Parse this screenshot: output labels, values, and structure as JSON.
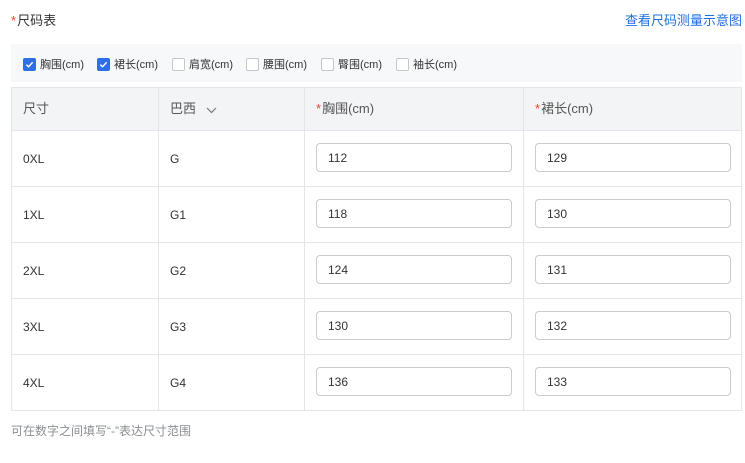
{
  "header": {
    "required_mark": "*",
    "title": "尺码表",
    "guide_link": "查看尺码测量示意图"
  },
  "filters": [
    {
      "label": "胸围(cm)",
      "checked": true
    },
    {
      "label": "裙长(cm)",
      "checked": true
    },
    {
      "label": "肩宽(cm)",
      "checked": false
    },
    {
      "label": "腰围(cm)",
      "checked": false
    },
    {
      "label": "臀围(cm)",
      "checked": false
    },
    {
      "label": "袖长(cm)",
      "checked": false
    }
  ],
  "table": {
    "headers": {
      "size": "尺寸",
      "region": "巴西",
      "chest": "胸围(cm)",
      "length": "裙长(cm)"
    },
    "rows": [
      {
        "size": "0XL",
        "region": "G",
        "chest": "112",
        "length": "129"
      },
      {
        "size": "1XL",
        "region": "G1",
        "chest": "118",
        "length": "130"
      },
      {
        "size": "2XL",
        "region": "G2",
        "chest": "124",
        "length": "131"
      },
      {
        "size": "3XL",
        "region": "G3",
        "chest": "130",
        "length": "132"
      },
      {
        "size": "4XL",
        "region": "G4",
        "chest": "136",
        "length": "133"
      }
    ]
  },
  "hint": "可在数字之间填写“-”表达尺寸范围",
  "colors": {
    "accent": "#2f6fe4",
    "link": "#1f6fe0",
    "required": "#e5462a"
  }
}
